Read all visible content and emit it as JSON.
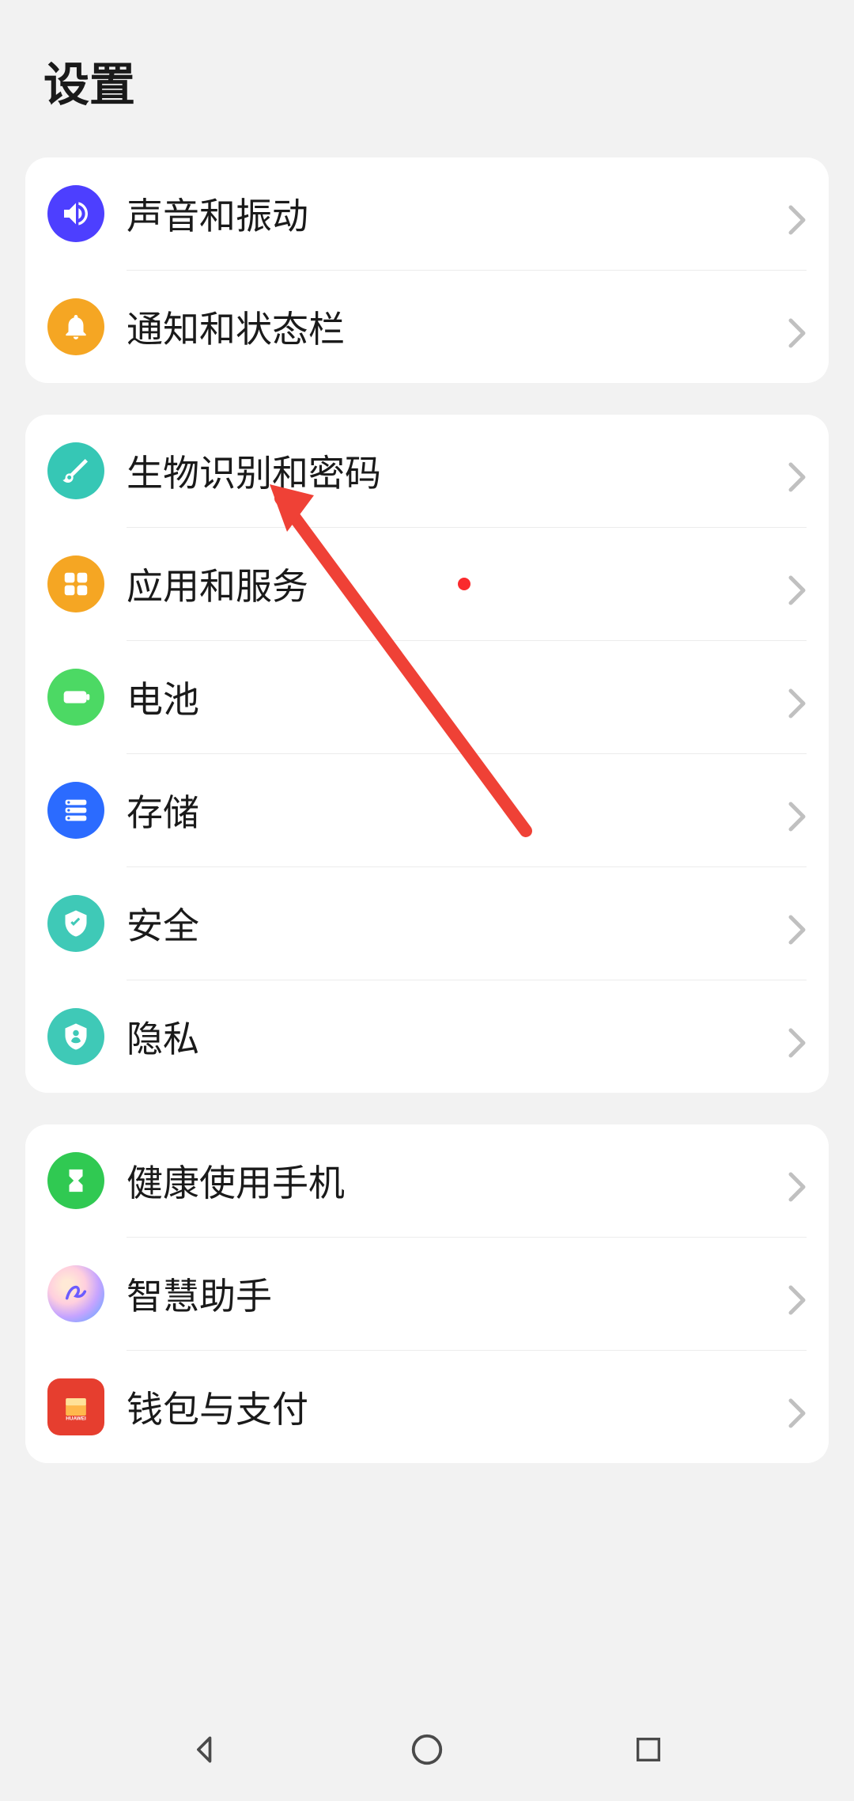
{
  "title": "设置",
  "groups": [
    {
      "items": [
        {
          "id": "sound",
          "label": "声音和振动",
          "icon": "volume",
          "bg": "#4d3fff"
        },
        {
          "id": "notifications",
          "label": "通知和状态栏",
          "icon": "bell",
          "bg": "#f5a623"
        }
      ]
    },
    {
      "items": [
        {
          "id": "biometrics",
          "label": "生物识别和密码",
          "icon": "key",
          "bg": "#36c7b5"
        },
        {
          "id": "apps",
          "label": "应用和服务",
          "icon": "grid",
          "bg": "#f5a623",
          "badge": true
        },
        {
          "id": "battery",
          "label": "电池",
          "icon": "battery",
          "bg": "#4cd964"
        },
        {
          "id": "storage",
          "label": "存储",
          "icon": "storage",
          "bg": "#2b6bff"
        },
        {
          "id": "security",
          "label": "安全",
          "icon": "shield",
          "bg": "#3fc9b7"
        },
        {
          "id": "privacy",
          "label": "隐私",
          "icon": "privacy",
          "bg": "#3fc9b7"
        }
      ]
    },
    {
      "items": [
        {
          "id": "digital-balance",
          "label": "健康使用手机",
          "icon": "hourglass",
          "bg": "#30c952"
        },
        {
          "id": "smart-assist",
          "label": "智慧助手",
          "icon": "smart",
          "bg": "gradient"
        },
        {
          "id": "wallet",
          "label": "钱包与支付",
          "icon": "wallet",
          "bg": "#e63e2f"
        }
      ]
    }
  ]
}
